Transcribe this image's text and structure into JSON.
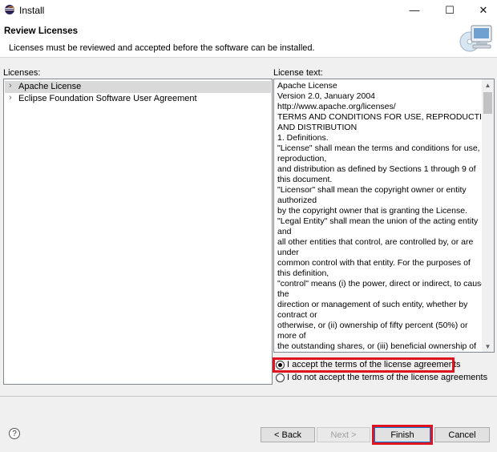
{
  "window": {
    "title": "Install",
    "minimize_glyph": "—",
    "maximize_glyph": "☐",
    "close_glyph": "✕"
  },
  "header": {
    "title": "Review Licenses",
    "description": "Licenses must be reviewed and accepted before the software can be installed."
  },
  "licenses": {
    "label": "Licenses:",
    "items": [
      {
        "label": "Apache License",
        "selected": true
      },
      {
        "label": "Eclipse Foundation Software User Agreement",
        "selected": false
      }
    ]
  },
  "license_text": {
    "label": "License text:",
    "lines": [
      "Apache License",
      "Version 2.0, January 2004",
      "http://www.apache.org/licenses/",
      "TERMS AND CONDITIONS FOR USE, REPRODUCTION,",
      "AND DISTRIBUTION",
      "1. Definitions.",
      "\"License\" shall mean the terms and conditions for use,",
      "reproduction,",
      "and distribution as defined by Sections 1 through 9 of",
      "this document.",
      "\"Licensor\" shall mean the copyright owner or entity",
      "authorized",
      "by the copyright owner that is granting the License.",
      "\"Legal Entity\" shall mean the union of the acting entity",
      "and",
      "all other entities that control, are controlled by, or are",
      "under",
      "common control with that entity. For the purposes of",
      "this definition,",
      "\"control\" means (i) the power, direct or indirect, to cause",
      "the",
      "direction or management of such entity, whether by",
      "contract or",
      "otherwise, or (ii) ownership of fifty percent (50%) or",
      "more of",
      "the outstanding shares, or (iii) beneficial ownership of"
    ]
  },
  "agreement": {
    "accept_label": "I accept the terms of the license agreements",
    "decline_label": "I do not accept the terms of the license agreements",
    "selected": "accept"
  },
  "buttons": {
    "help": "?",
    "back": "< Back",
    "next": "Next >",
    "finish": "Finish",
    "cancel": "Cancel"
  },
  "icons": {
    "app": "eclipse-icon",
    "wizard": "monitor-cd-icon",
    "help": "help-icon",
    "tree_arrow": "chevron-right-icon",
    "scroll_up": "scroll-up-arrow-icon",
    "scroll_down": "scroll-down-arrow-icon"
  },
  "colors": {
    "highlight": "#e0141e",
    "selection": "#d9d9d9",
    "default_button_border": "#0078d7"
  }
}
